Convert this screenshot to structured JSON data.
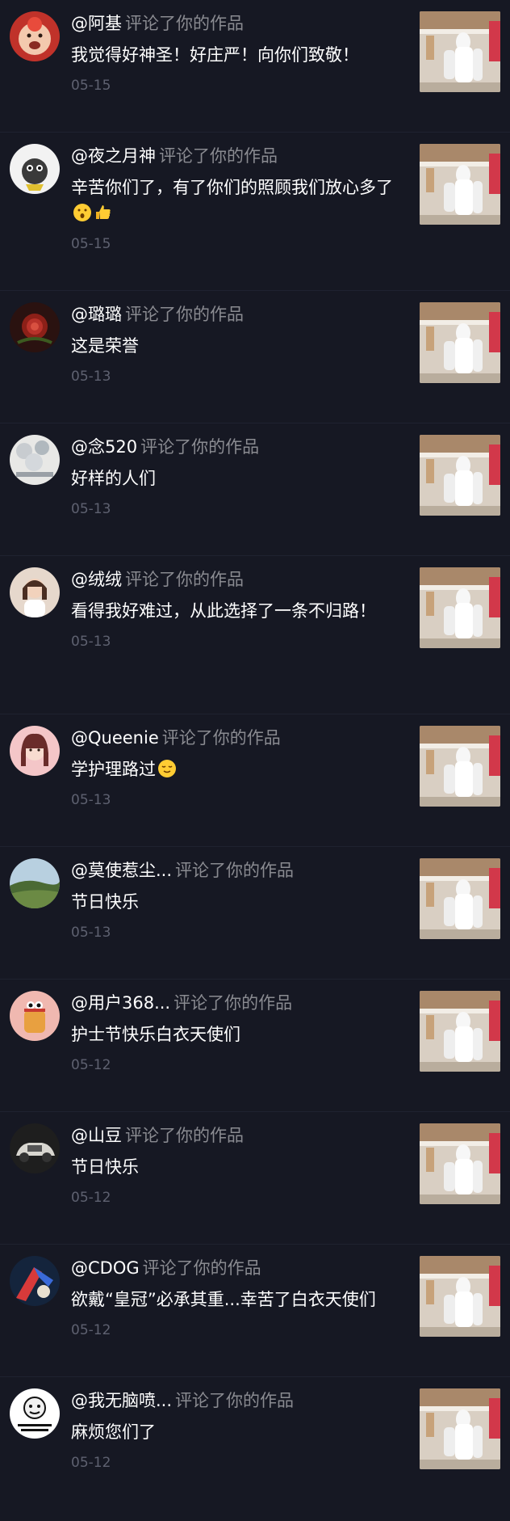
{
  "notifications": [
    {
      "user": "@阿基",
      "action": "评论了你的作品",
      "comment": "我觉得好神圣！好庄严！向你们致敬！",
      "date": "05-15",
      "avatar_icon": "baby-face-avatar",
      "emoji_icons": []
    },
    {
      "user": "@夜之月神",
      "action": "评论了你的作品",
      "comment": "辛苦你们了，有了你们的照顾我们放心多了",
      "date": "05-15",
      "avatar_icon": "cartoon-character-avatar",
      "emoji_icons": [
        "surprised-face-emoji",
        "thumbs-up-emoji"
      ]
    },
    {
      "user": "@璐璐",
      "action": "评论了你的作品",
      "comment": "这是荣誉",
      "date": "05-13",
      "avatar_icon": "rose-avatar",
      "emoji_icons": []
    },
    {
      "user": "@念520",
      "action": "评论了你的作品",
      "comment": "好样的人们",
      "date": "05-13",
      "avatar_icon": "flower-photo-avatar",
      "emoji_icons": []
    },
    {
      "user": "@绒绒",
      "action": "评论了你的作品",
      "comment": "看得我好难过，从此选择了一条不归路！",
      "date": "05-13",
      "avatar_icon": "girl-portrait-avatar",
      "emoji_icons": []
    },
    {
      "user": "@Queenie",
      "action": "评论了你的作品",
      "comment": "学护理路过",
      "date": "05-13",
      "avatar_icon": "girl-portrait-avatar",
      "emoji_icons": [
        "relieved-face-emoji"
      ]
    },
    {
      "user": "@莫使惹尘...",
      "action": "评论了你的作品",
      "comment": "节日快乐",
      "date": "05-13",
      "avatar_icon": "landscape-avatar",
      "emoji_icons": []
    },
    {
      "user": "@用户368...",
      "action": "评论了你的作品",
      "comment": "护士节快乐白衣天使们",
      "date": "05-12",
      "avatar_icon": "cartoon-cup-avatar",
      "emoji_icons": []
    },
    {
      "user": "@山豆",
      "action": "评论了你的作品",
      "comment": "节日快乐",
      "date": "05-12",
      "avatar_icon": "car-avatar",
      "emoji_icons": []
    },
    {
      "user": "@CDOG",
      "action": "评论了你的作品",
      "comment": "欲戴“皇冠”必承其重...幸苦了白衣天使们",
      "date": "05-12",
      "avatar_icon": "abstract-avatar",
      "emoji_icons": []
    },
    {
      "user": "@我无脑喷...",
      "action": "评论了你的作品",
      "comment": "麻烦您们了",
      "date": "05-12",
      "avatar_icon": "meme-face-avatar",
      "emoji_icons": []
    }
  ],
  "thumbnail_icon": "nurses-video-thumbnail",
  "colors": {
    "background": "#161823",
    "username": "#ffffff",
    "action": "#8a8b91",
    "date": "#5e6170",
    "divider": "#1f2230"
  }
}
